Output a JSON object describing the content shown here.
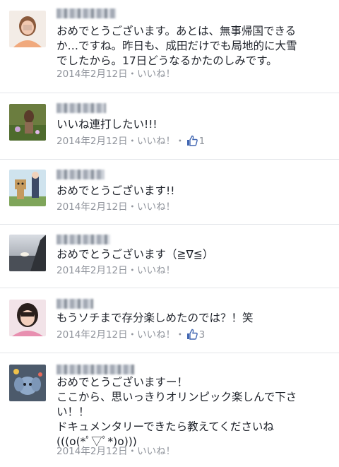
{
  "comments": [
    {
      "name": "",
      "text": "おめでとうございます。あとは、無事帰国できる\nか…ですね。昨日も、成田だけでも局地的に大雪\nでしたから。17日どうなるかたのしみです。",
      "date": "2014年2月12日",
      "sep": "・",
      "like_label": "いいね！",
      "like_count": ""
    },
    {
      "name": "",
      "text": "いいね連打したい!!!",
      "date": "2014年2月12日",
      "sep": "・",
      "like_label": "いいね！",
      "like_count": "1"
    },
    {
      "name": "",
      "text": "おめでとうございます!!",
      "date": "2014年2月12日",
      "sep": "・",
      "like_label": "いいね！",
      "like_count": ""
    },
    {
      "name": "",
      "text": "おめでとうございます（≧∇≦）",
      "date": "2014年2月12日",
      "sep": "・",
      "like_label": "いいね！",
      "like_count": ""
    },
    {
      "name": "",
      "text": "もうソチまで存分楽しめたのでは？！笑",
      "date": "2014年2月12日",
      "sep": "・",
      "like_label": "いいね！",
      "like_count": "3"
    },
    {
      "name": "",
      "text": "おめでとうございますー！\nここから、思いっきりオリンピック楽しんで下さ\nい！！\nドキュメンタリーできたら教えてくださいね\n(((o(*ﾟ▽ﾟ*)o)))",
      "date": "2014年2月12日",
      "sep": "・",
      "like_label": "いいね！",
      "like_count": ""
    }
  ],
  "colors": {
    "meta": "#90949c",
    "like_blue": "#4267b2",
    "divider": "#e3e5e9"
  }
}
